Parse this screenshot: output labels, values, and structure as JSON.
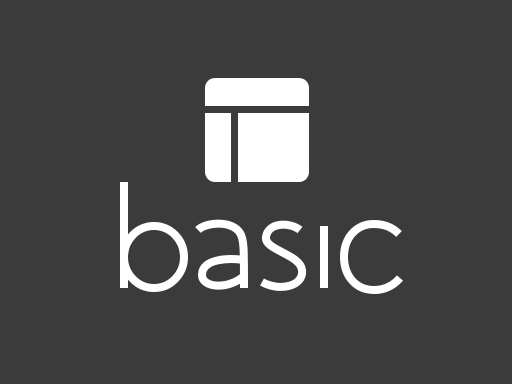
{
  "brand": {
    "wordmark": "basic",
    "logo_icon": "layout-grid-icon",
    "colors": {
      "background": "#3b3b3b",
      "foreground": "#ffffff"
    }
  }
}
